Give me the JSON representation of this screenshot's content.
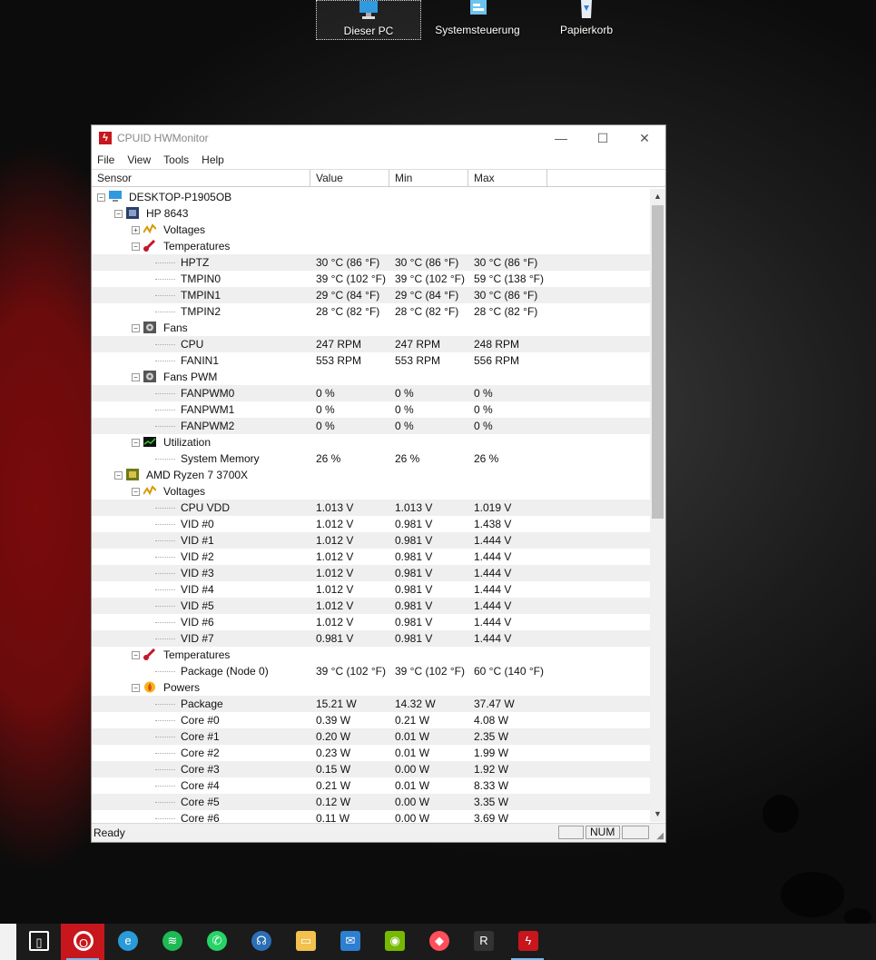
{
  "desktop": {
    "icons": [
      {
        "label": "Dieser PC",
        "icon": "computer-icon"
      },
      {
        "label": "Systemsteuerung",
        "icon": "control-panel-icon"
      },
      {
        "label": "Papierkorb",
        "icon": "recycle-bin-icon"
      }
    ]
  },
  "window": {
    "title": "CPUID HWMonitor",
    "controls": {
      "minimize": "—",
      "maximize": "☐",
      "close": "✕"
    },
    "menu": [
      "File",
      "View",
      "Tools",
      "Help"
    ],
    "columns": [
      "Sensor",
      "Value",
      "Min",
      "Max"
    ],
    "status": {
      "text": "Ready",
      "num": "NUM"
    }
  },
  "tree": [
    {
      "level": 0,
      "type": "device",
      "name": "DESKTOP-P1905OB",
      "icon": "computer-icon",
      "expander": "−"
    },
    {
      "level": 1,
      "type": "device",
      "name": "HP 8643",
      "icon": "motherboard-icon",
      "expander": "−"
    },
    {
      "level": 2,
      "type": "group",
      "name": "Voltages",
      "icon": "voltage-icon",
      "expander": "+"
    },
    {
      "level": 2,
      "type": "group",
      "name": "Temperatures",
      "icon": "thermometer-icon",
      "expander": "−"
    },
    {
      "level": 3,
      "type": "sensor",
      "name": "HPTZ",
      "value": "30 °C  (86 °F)",
      "min": "30 °C  (86 °F)",
      "max": "30 °C  (86 °F)"
    },
    {
      "level": 3,
      "type": "sensor",
      "name": "TMPIN0",
      "value": "39 °C  (102 °F)",
      "min": "39 °C  (102 °F)",
      "max": "59 °C  (138 °F)"
    },
    {
      "level": 3,
      "type": "sensor",
      "name": "TMPIN1",
      "value": "29 °C  (84 °F)",
      "min": "29 °C  (84 °F)",
      "max": "30 °C  (86 °F)"
    },
    {
      "level": 3,
      "type": "sensor",
      "name": "TMPIN2",
      "value": "28 °C  (82 °F)",
      "min": "28 °C  (82 °F)",
      "max": "28 °C  (82 °F)"
    },
    {
      "level": 2,
      "type": "group",
      "name": "Fans",
      "icon": "fan-icon",
      "expander": "−"
    },
    {
      "level": 3,
      "type": "sensor",
      "name": "CPU",
      "value": "247 RPM",
      "min": "247 RPM",
      "max": "248 RPM"
    },
    {
      "level": 3,
      "type": "sensor",
      "name": "FANIN1",
      "value": "553 RPM",
      "min": "553 RPM",
      "max": "556 RPM"
    },
    {
      "level": 2,
      "type": "group",
      "name": "Fans PWM",
      "icon": "fan-icon",
      "expander": "−"
    },
    {
      "level": 3,
      "type": "sensor",
      "name": "FANPWM0",
      "value": "0 %",
      "min": "0 %",
      "max": "0 %"
    },
    {
      "level": 3,
      "type": "sensor",
      "name": "FANPWM1",
      "value": "0 %",
      "min": "0 %",
      "max": "0 %"
    },
    {
      "level": 3,
      "type": "sensor",
      "name": "FANPWM2",
      "value": "0 %",
      "min": "0 %",
      "max": "0 %"
    },
    {
      "level": 2,
      "type": "group",
      "name": "Utilization",
      "icon": "utilization-icon",
      "expander": "−"
    },
    {
      "level": 3,
      "type": "sensor",
      "name": "System Memory",
      "value": "26 %",
      "min": "26 %",
      "max": "26 %"
    },
    {
      "level": 1,
      "type": "device",
      "name": "AMD Ryzen 7 3700X",
      "icon": "cpu-chip-icon",
      "expander": "−"
    },
    {
      "level": 2,
      "type": "group",
      "name": "Voltages",
      "icon": "voltage-icon",
      "expander": "−"
    },
    {
      "level": 3,
      "type": "sensor",
      "name": "CPU VDD",
      "value": "1.013 V",
      "min": "1.013 V",
      "max": "1.019 V"
    },
    {
      "level": 3,
      "type": "sensor",
      "name": "VID #0",
      "value": "1.012 V",
      "min": "0.981 V",
      "max": "1.438 V"
    },
    {
      "level": 3,
      "type": "sensor",
      "name": "VID #1",
      "value": "1.012 V",
      "min": "0.981 V",
      "max": "1.444 V"
    },
    {
      "level": 3,
      "type": "sensor",
      "name": "VID #2",
      "value": "1.012 V",
      "min": "0.981 V",
      "max": "1.444 V"
    },
    {
      "level": 3,
      "type": "sensor",
      "name": "VID #3",
      "value": "1.012 V",
      "min": "0.981 V",
      "max": "1.444 V"
    },
    {
      "level": 3,
      "type": "sensor",
      "name": "VID #4",
      "value": "1.012 V",
      "min": "0.981 V",
      "max": "1.444 V"
    },
    {
      "level": 3,
      "type": "sensor",
      "name": "VID #5",
      "value": "1.012 V",
      "min": "0.981 V",
      "max": "1.444 V"
    },
    {
      "level": 3,
      "type": "sensor",
      "name": "VID #6",
      "value": "1.012 V",
      "min": "0.981 V",
      "max": "1.444 V"
    },
    {
      "level": 3,
      "type": "sensor",
      "name": "VID #7",
      "value": "0.981 V",
      "min": "0.981 V",
      "max": "1.444 V"
    },
    {
      "level": 2,
      "type": "group",
      "name": "Temperatures",
      "icon": "thermometer-icon",
      "expander": "−"
    },
    {
      "level": 3,
      "type": "sensor",
      "name": "Package (Node 0)",
      "value": "39 °C  (102 °F)",
      "min": "39 °C  (102 °F)",
      "max": "60 °C  (140 °F)"
    },
    {
      "level": 2,
      "type": "group",
      "name": "Powers",
      "icon": "power-flame-icon",
      "expander": "−"
    },
    {
      "level": 3,
      "type": "sensor",
      "name": "Package",
      "value": "15.21 W",
      "min": "14.32 W",
      "max": "37.47 W"
    },
    {
      "level": 3,
      "type": "sensor",
      "name": "Core #0",
      "value": "0.39 W",
      "min": "0.21 W",
      "max": "4.08 W"
    },
    {
      "level": 3,
      "type": "sensor",
      "name": "Core #1",
      "value": "0.20 W",
      "min": "0.01 W",
      "max": "2.35 W"
    },
    {
      "level": 3,
      "type": "sensor",
      "name": "Core #2",
      "value": "0.23 W",
      "min": "0.01 W",
      "max": "1.99 W"
    },
    {
      "level": 3,
      "type": "sensor",
      "name": "Core #3",
      "value": "0.15 W",
      "min": "0.00 W",
      "max": "1.92 W"
    },
    {
      "level": 3,
      "type": "sensor",
      "name": "Core #4",
      "value": "0.21 W",
      "min": "0.01 W",
      "max": "8.33 W"
    },
    {
      "level": 3,
      "type": "sensor",
      "name": "Core #5",
      "value": "0.12 W",
      "min": "0.00 W",
      "max": "3.35 W"
    },
    {
      "level": 3,
      "type": "sensor",
      "name": "Core #6",
      "value": "0.11 W",
      "min": "0.00 W",
      "max": "3.69 W"
    }
  ],
  "taskbar": {
    "items": [
      {
        "name": "task-view-icon",
        "color": "#ffffff",
        "glyph": "▯"
      },
      {
        "name": "opera-icon",
        "color": "#e4232b",
        "glyph": "O",
        "active": true
      },
      {
        "name": "edge-icon",
        "color": "#2a9bd8",
        "glyph": "e"
      },
      {
        "name": "spotify-icon",
        "color": "#1db954",
        "glyph": "≋"
      },
      {
        "name": "whatsapp-icon",
        "color": "#25d366",
        "glyph": "✆"
      },
      {
        "name": "support-assistant-icon",
        "color": "#2b6fb6",
        "glyph": "☊"
      },
      {
        "name": "file-explorer-icon",
        "color": "#f2c14e",
        "glyph": "▭"
      },
      {
        "name": "mail-icon",
        "color": "#2d7fd0",
        "glyph": "✉"
      },
      {
        "name": "nvidia-icon",
        "color": "#76b900",
        "glyph": "◉"
      },
      {
        "name": "shortcut-app-icon",
        "color": "#ff4f5a",
        "glyph": "◆"
      },
      {
        "name": "ryzen-master-icon",
        "color": "#333333",
        "glyph": "R"
      },
      {
        "name": "hwmonitor-taskbar-icon",
        "color": "#c8161d",
        "glyph": "ϟ",
        "active": true
      }
    ]
  }
}
